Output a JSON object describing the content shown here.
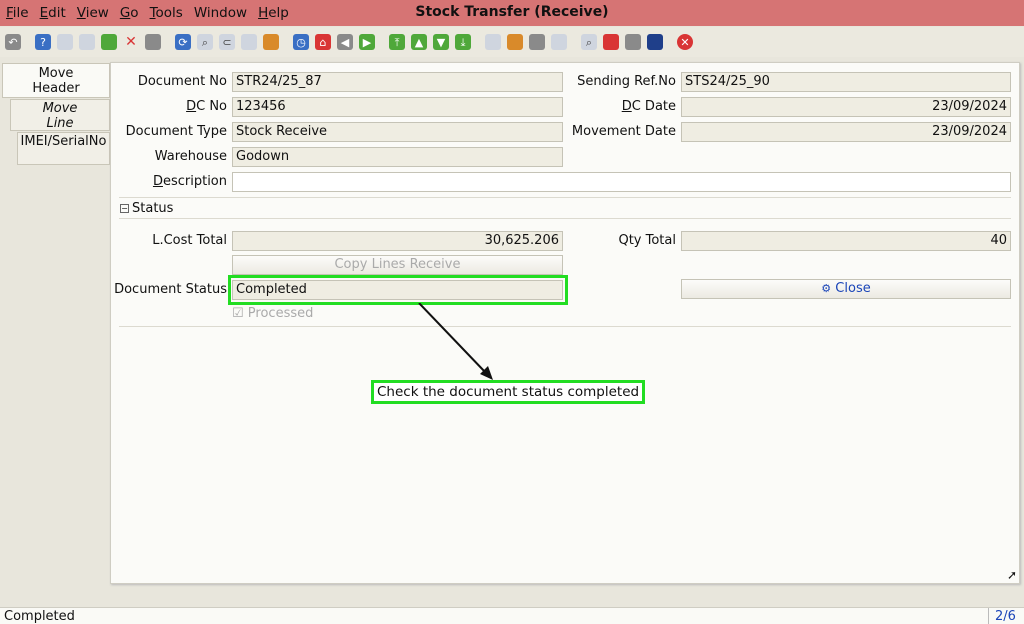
{
  "window": {
    "title": "Stock Transfer (Receive)"
  },
  "menu": [
    {
      "u": "F",
      "rest": "ile"
    },
    {
      "u": "E",
      "rest": "dit"
    },
    {
      "u": "V",
      "rest": "iew"
    },
    {
      "u": "G",
      "rest": "o"
    },
    {
      "u": "T",
      "rest": "ools"
    },
    {
      "u": "",
      "rest": "Window"
    },
    {
      "u": "H",
      "rest": "elp"
    }
  ],
  "toolbar": {
    "icons": [
      "undo-icon",
      "help-icon",
      "new-icon",
      "copy-icon",
      "save-new-icon",
      "delete-icon",
      "save-icon",
      "refresh-icon",
      "find-icon",
      "attachment-icon",
      "chat-icon",
      "grid-toggle-icon",
      "history-icon",
      "home-icon",
      "back-icon",
      "forward-icon",
      "first-record-icon",
      "previous-record-icon",
      "next-record-icon",
      "last-record-icon",
      "report-icon",
      "archive-icon",
      "print-icon",
      "print-preview-icon",
      "zoom-across-icon",
      "workflow-icon",
      "product-info-icon",
      "active-workflows-icon",
      "exit-icon"
    ]
  },
  "tabs": {
    "move_header_1": "Move",
    "move_header_2": "Header",
    "move_line_1": "Move",
    "move_line_2": "Line",
    "imei": "IMEI/SerialNo"
  },
  "form": {
    "document_no_label": "Document No",
    "document_no": "STR24/25_87",
    "sending_ref_label": "Sending Ref.No",
    "sending_ref": "STS24/25_90",
    "dc_no_label_u": "D",
    "dc_no_label_rest": "C No",
    "dc_no": "123456",
    "dc_date_label_u": "D",
    "dc_date_label_rest": "C Date",
    "dc_date": "23/09/2024",
    "document_type_label": "Document Type",
    "document_type": "Stock Receive",
    "movement_date_label": "Movement Date",
    "movement_date": "23/09/2024",
    "warehouse_label": "Warehouse",
    "warehouse": "Godown",
    "description_label_u": "D",
    "description_label_rest": "escription",
    "description": ""
  },
  "status_section": {
    "title": "Status",
    "lcost_label": "L.Cost Total",
    "lcost": "30,625.206",
    "qty_label": "Qty Total",
    "qty": "40",
    "copy_lines": "Copy Lines Receive",
    "doc_status_label": "Document Status",
    "doc_status": "Completed",
    "close": "Close",
    "processed": "Processed"
  },
  "annotation": {
    "text": "Check the document status completed"
  },
  "statusbar": {
    "text": "Completed",
    "page": "2/6"
  },
  "colors": {
    "titlebar": "#d67474",
    "highlight": "#22dd22",
    "link": "#1b45b8"
  }
}
